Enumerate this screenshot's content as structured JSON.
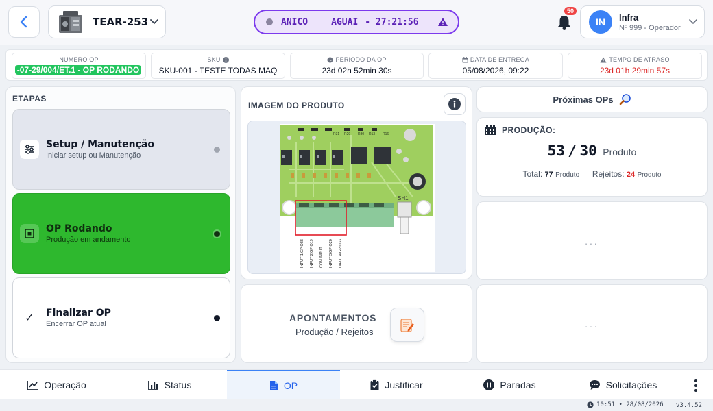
{
  "header": {
    "machine_name": "TEAR-253",
    "status": {
      "segments": [
        "ANICO",
        "AGUAI",
        "- 27:21:56"
      ]
    },
    "notifications_count": "50",
    "user": {
      "initials": "IN",
      "name": "Infra",
      "role": "Nº 999 - Operador"
    }
  },
  "infobar": {
    "numero_op": {
      "label": "NUMERO OP",
      "value": "-07-29/004/ET.1 - OP RODANDO"
    },
    "sku": {
      "label": "SKU",
      "value": "SKU-001 - TESTE TODAS MAQ"
    },
    "periodo": {
      "label": "PERIODO DA OP",
      "value": "23d 02h 52min 30s"
    },
    "entrega": {
      "label": "DATA DE ENTREGA",
      "value": "05/08/2026, 09:22"
    },
    "atraso": {
      "label": "TEMPO DE ATRASO",
      "value": "23d 01h 29min 57s"
    }
  },
  "etapas": {
    "title": "ETAPAS",
    "steps": [
      {
        "title": "Setup / Manutenção",
        "subtitle": "Iniciar setup ou Manutenção"
      },
      {
        "title": "OP Rodando",
        "subtitle": "Produção em andamento"
      },
      {
        "title": "Finalizar OP",
        "subtitle": "Encerrar OP atual"
      }
    ]
  },
  "product_image": {
    "title": "IMAGEM DO PRODUTO",
    "pcb_labels": [
      "SH1",
      "INPUT 1",
      "GPIO88",
      "INPUT 2",
      "GPIO19",
      "COM INPUT",
      "INPUT 3",
      "GPIO20",
      "INPUT 4",
      "GPIO33",
      "R31",
      "R29",
      "R30",
      "R13",
      "R16"
    ]
  },
  "apontamentos": {
    "title": "APONTAMENTOS",
    "subtitle": "Produção / Rejeitos"
  },
  "proximas": {
    "title": "Próximas OPs"
  },
  "producao": {
    "title": "PRODUÇÃO:",
    "current": "53",
    "separator": "/",
    "target": "30",
    "unit": "Produto",
    "total_label": "Total:",
    "total_value": "77",
    "rejeitos_label": "Rejeitos:",
    "rejeitos_value": "24",
    "unit_small": "Produto"
  },
  "placeholders": {
    "empty1": "...",
    "empty2": "..."
  },
  "nav": {
    "tabs": [
      "Operação",
      "Status",
      "OP",
      "Justificar",
      "Paradas",
      "Solicitações"
    ],
    "active": "OP"
  },
  "footer": {
    "clock": "10:51 • 28/08/2026",
    "version": "v3.4.52"
  },
  "colors": {
    "accent": "#3b82f6",
    "running": "#2eb82e",
    "status_border": "#7c3aed",
    "danger": "#dc2626"
  },
  "icons": [
    "chevron-left-icon",
    "machine-icon",
    "chevron-down-icon",
    "warning-icon",
    "bell-icon",
    "clock-icon",
    "calendar-icon",
    "info-icon",
    "sliders-icon",
    "stop-icon",
    "check-icon",
    "edit-note-icon",
    "search-icon",
    "factory-icon",
    "chart-line-icon",
    "bar-chart-icon",
    "document-icon",
    "clipboard-check-icon",
    "pause-icon",
    "chat-icon",
    "kebab-menu-icon"
  ]
}
